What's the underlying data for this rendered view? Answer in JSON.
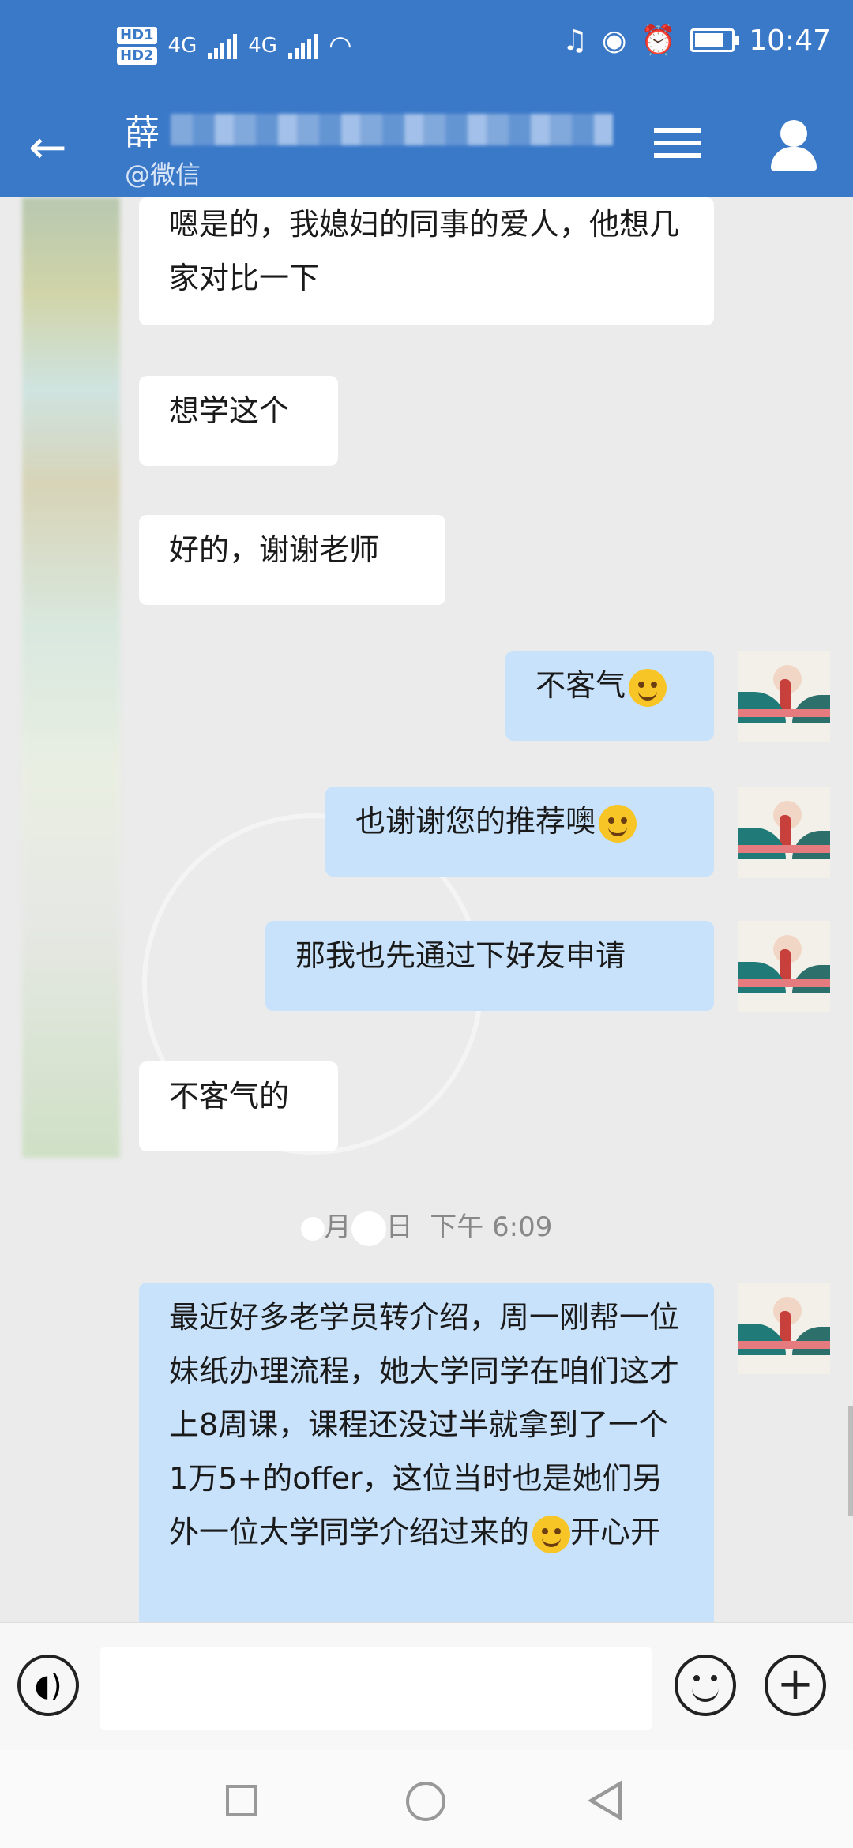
{
  "status_bar": {
    "hd_labels": [
      "HD1",
      "HD2"
    ],
    "network_labels": [
      "4G",
      "4G"
    ],
    "time": "10:47"
  },
  "header": {
    "title": "薛",
    "subtitle": "@微信",
    "back_icon": "arrow-left-icon",
    "menu_icon": "menu-icon",
    "contact_icon": "person-icon"
  },
  "messages": [
    {
      "side": "left",
      "text": "嗯是的，我媳妇的同事的爱人，他想几家对比一下"
    },
    {
      "side": "left",
      "text": "想学这个"
    },
    {
      "side": "left",
      "text": "好的，谢谢老师"
    },
    {
      "side": "right",
      "text": "不客气",
      "emoji": "smile-emoji"
    },
    {
      "side": "right",
      "text": "也谢谢您的推荐噢",
      "emoji": "wink-emoji"
    },
    {
      "side": "right",
      "text": "那我也先通过下好友申请"
    },
    {
      "side": "left",
      "text": "不客气的"
    },
    {
      "side": "right",
      "text": "最近好多老学员转介绍，周一刚帮一位妹纸办理流程，她大学同学在咱们这才上8周课，课程还没过半就拿到了一个1万5+的offer，这位当时也是她们另外一位大学同学介绍过来的",
      "trailing": "开心开"
    }
  ],
  "timestamp": {
    "month_label": "月",
    "day_label": "日",
    "time_label": "下午 6:09"
  },
  "input_bar": {
    "voice_icon": "voice-icon",
    "emoji_icon": "emoji-icon",
    "add_icon": "plus-icon",
    "placeholder": ""
  },
  "nav_bar": {
    "icons": [
      "recent-apps-icon",
      "home-icon",
      "back-icon"
    ]
  },
  "colors": {
    "header_blue": "#3a78c8",
    "bubble_left": "#ffffff",
    "bubble_right": "#c9e2fb",
    "chat_bg": "#ebebeb"
  }
}
